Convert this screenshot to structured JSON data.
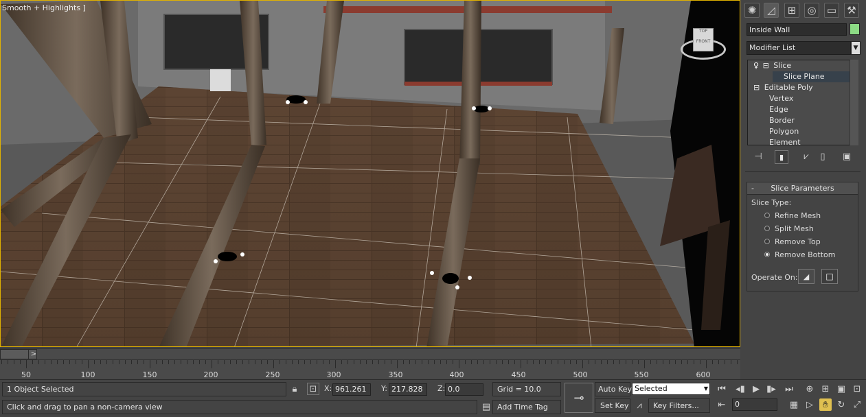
{
  "viewport": {
    "label": "Smooth + Highlights ]",
    "viewcube_top": "TOP",
    "viewcube_front": "FRONT"
  },
  "command_panel": {
    "tabs": [
      "create-icon",
      "modify-icon",
      "hierarchy-icon",
      "motion-icon",
      "display-icon",
      "utilities-icon"
    ],
    "object_name": "Inside Wall",
    "object_color": "#8ddc85",
    "modifier_list": "Modifier List",
    "stack": [
      {
        "label": "Slice",
        "level": 0
      },
      {
        "label": "Slice Plane",
        "level": 1,
        "selected": true
      },
      {
        "label": "Editable Poly",
        "level": 0
      },
      {
        "label": "Vertex",
        "level": 1
      },
      {
        "label": "Edge",
        "level": 1
      },
      {
        "label": "Border",
        "level": 1
      },
      {
        "label": "Polygon",
        "level": 1
      },
      {
        "label": "Element",
        "level": 1
      }
    ],
    "rollout": {
      "title": "Slice Parameters",
      "collapse": "-",
      "slice_type_label": "Slice Type:",
      "options": [
        {
          "label": "Refine Mesh",
          "checked": false
        },
        {
          "label": "Split Mesh",
          "checked": false
        },
        {
          "label": "Remove Top",
          "checked": false
        },
        {
          "label": "Remove Bottom",
          "checked": true
        }
      ],
      "operate_on_label": "Operate On:"
    }
  },
  "timeline": {
    "slider_arrow": ">",
    "ruler_labels": [
      "50",
      "100",
      "150",
      "200",
      "250",
      "300",
      "350",
      "400",
      "450",
      "500",
      "550",
      "600"
    ]
  },
  "status": {
    "selection": "1 Object Selected",
    "prompt": "Click and drag to pan a non-camera view",
    "x_label": "X:",
    "x_value": "961.261",
    "y_label": "Y:",
    "y_value": "217.828",
    "z_label": "Z:",
    "z_value": "0.0",
    "grid": "Grid = 10.0",
    "add_time_tag": "Add Time Tag",
    "auto_key": "Auto Key",
    "set_key": "Set Key",
    "selected_dropdown": "Selected",
    "key_filters": "Key Filters...",
    "frame_value": "0"
  }
}
